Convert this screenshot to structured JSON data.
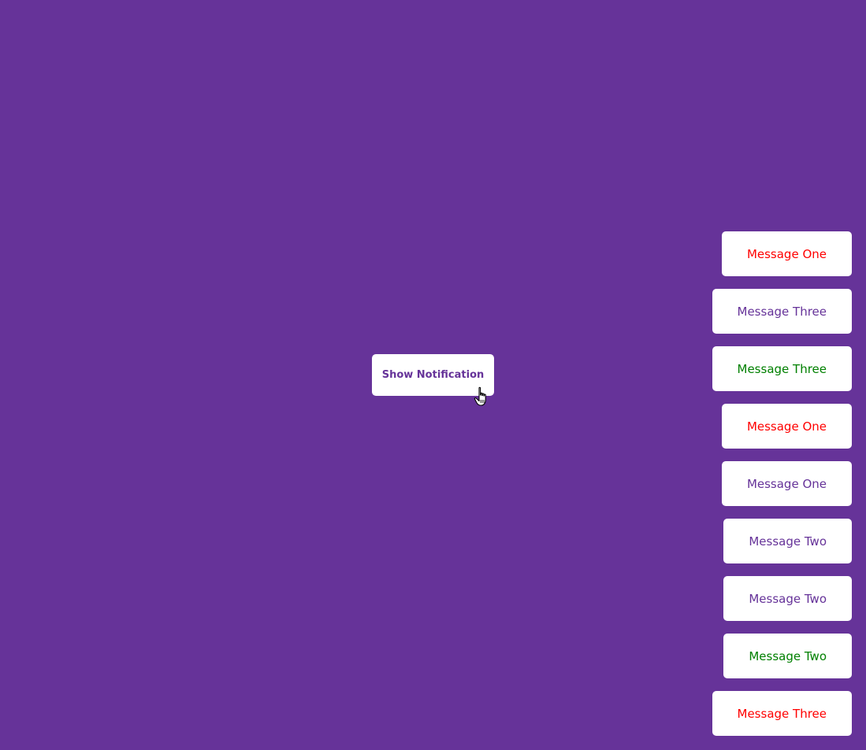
{
  "button": {
    "label": "Show Notification"
  },
  "colors": {
    "background": "#663399",
    "error": "#ff0000",
    "info": "#663399",
    "success": "#008000"
  },
  "cursor_icon": "hand-pointer-icon",
  "notifications": [
    {
      "message": "Message One",
      "type": "error"
    },
    {
      "message": "Message Three",
      "type": "info"
    },
    {
      "message": "Message Three",
      "type": "success"
    },
    {
      "message": "Message One",
      "type": "error"
    },
    {
      "message": "Message One",
      "type": "info"
    },
    {
      "message": "Message Two",
      "type": "info"
    },
    {
      "message": "Message Two",
      "type": "info"
    },
    {
      "message": "Message Two",
      "type": "success"
    },
    {
      "message": "Message Three",
      "type": "error"
    }
  ]
}
